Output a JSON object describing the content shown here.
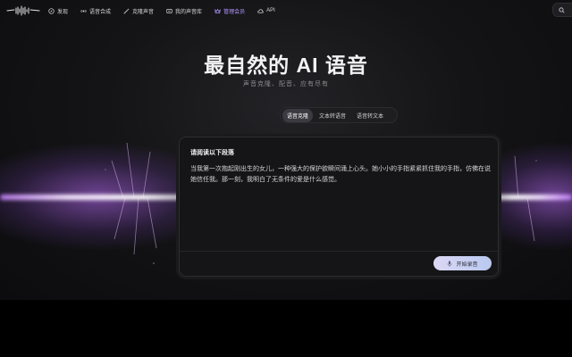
{
  "nav": {
    "items": [
      {
        "label": "发现",
        "icon": "compass-icon"
      },
      {
        "label": "语音合成",
        "icon": "audio-icon"
      },
      {
        "label": "克隆声音",
        "icon": "magic-wand-icon"
      },
      {
        "label": "我的声音库",
        "icon": "library-icon"
      },
      {
        "label": "管理会员",
        "icon": "crown-icon",
        "active": true
      },
      {
        "label": "API",
        "icon": "cloud-icon"
      }
    ]
  },
  "hero": {
    "title": "最自然的 AI 语音",
    "subtitle": "声音克隆、配音、应有尽有"
  },
  "tabs": [
    {
      "label": "语音克隆",
      "active": true
    },
    {
      "label": "文本转语音"
    },
    {
      "label": "语音转文本"
    }
  ],
  "card": {
    "title": "请阅读以下段落",
    "text": "当我第一次抱起刚出生的女儿，一种强大的保护欲瞬间涌上心头。她小小的手指紧紧抓住我的手指，仿佛在说她信任我。那一刻，我明白了无条件的爱是什么感觉。",
    "record_label": "开始录音"
  },
  "colors": {
    "accent": "#b197ff",
    "glow": "#c882ff"
  }
}
